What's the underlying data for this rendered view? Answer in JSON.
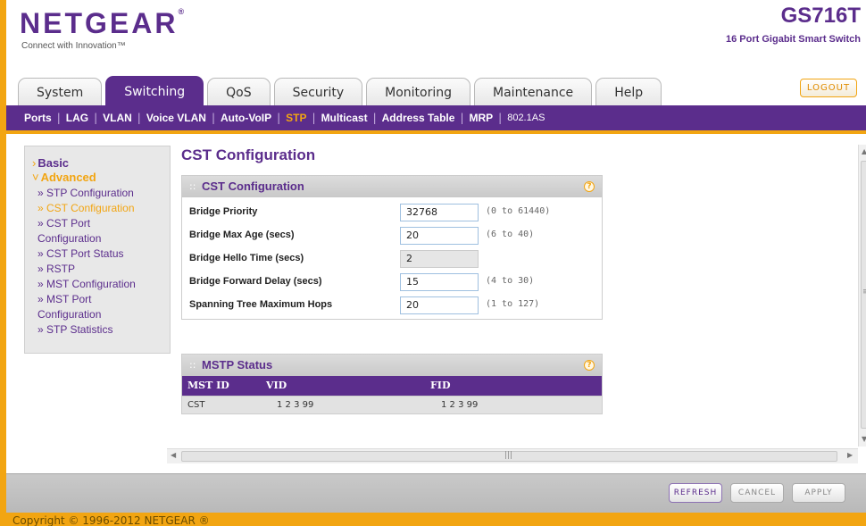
{
  "brand": {
    "logo": "NETGEAR",
    "logo_mark": "®",
    "tagline": "Connect with Innovation™",
    "model": "GS716T",
    "model_desc": "16 Port Gigabit Smart Switch",
    "accent": "#5b2d8c",
    "highlight": "#f2a512"
  },
  "tabs": [
    {
      "label": "System"
    },
    {
      "label": "Switching",
      "active": true
    },
    {
      "label": "QoS"
    },
    {
      "label": "Security"
    },
    {
      "label": "Monitoring"
    },
    {
      "label": "Maintenance"
    },
    {
      "label": "Help"
    }
  ],
  "logout_label": "LOGOUT",
  "subnav": [
    "Ports",
    "LAG",
    "VLAN",
    "Voice VLAN",
    "Auto-VoIP",
    "STP",
    "Multicast",
    "Address Table",
    "MRP",
    "802.1AS"
  ],
  "subnav_active": "STP",
  "leftnav": {
    "basic": "Basic",
    "advanced": "Advanced",
    "items": [
      "» STP Configuration",
      "» CST Configuration",
      "» CST Port",
      "Configuration",
      "» CST Port Status",
      "» RSTP",
      "» MST Configuration",
      "» MST Port",
      "Configuration",
      "» STP Statistics"
    ]
  },
  "page_title": "CST Configuration",
  "cst_panel": {
    "title": "CST Configuration",
    "fields": [
      {
        "label": "Bridge Priority",
        "value": "32768",
        "range": "(0 to 61440)"
      },
      {
        "label": "Bridge Max Age (secs)",
        "value": "20",
        "range": "(6 to 40)"
      },
      {
        "label": "Bridge Hello Time (secs)",
        "value": "2",
        "range": ""
      },
      {
        "label": "Bridge Forward Delay (secs)",
        "value": "15",
        "range": "(4 to 30)"
      },
      {
        "label": "Spanning Tree Maximum Hops",
        "value": "20",
        "range": "(1 to 127)"
      }
    ]
  },
  "mstp_panel": {
    "title": "MSTP Status",
    "columns": [
      "MST ID",
      "VID",
      "FID"
    ],
    "rows": [
      [
        "CST",
        "1 2 3 99",
        "1 2 3 99"
      ]
    ]
  },
  "buttons": {
    "refresh": "REFRESH",
    "cancel": "CANCEL",
    "apply": "APPLY"
  },
  "copyright": "Copyright © 1996-2012 NETGEAR ®"
}
